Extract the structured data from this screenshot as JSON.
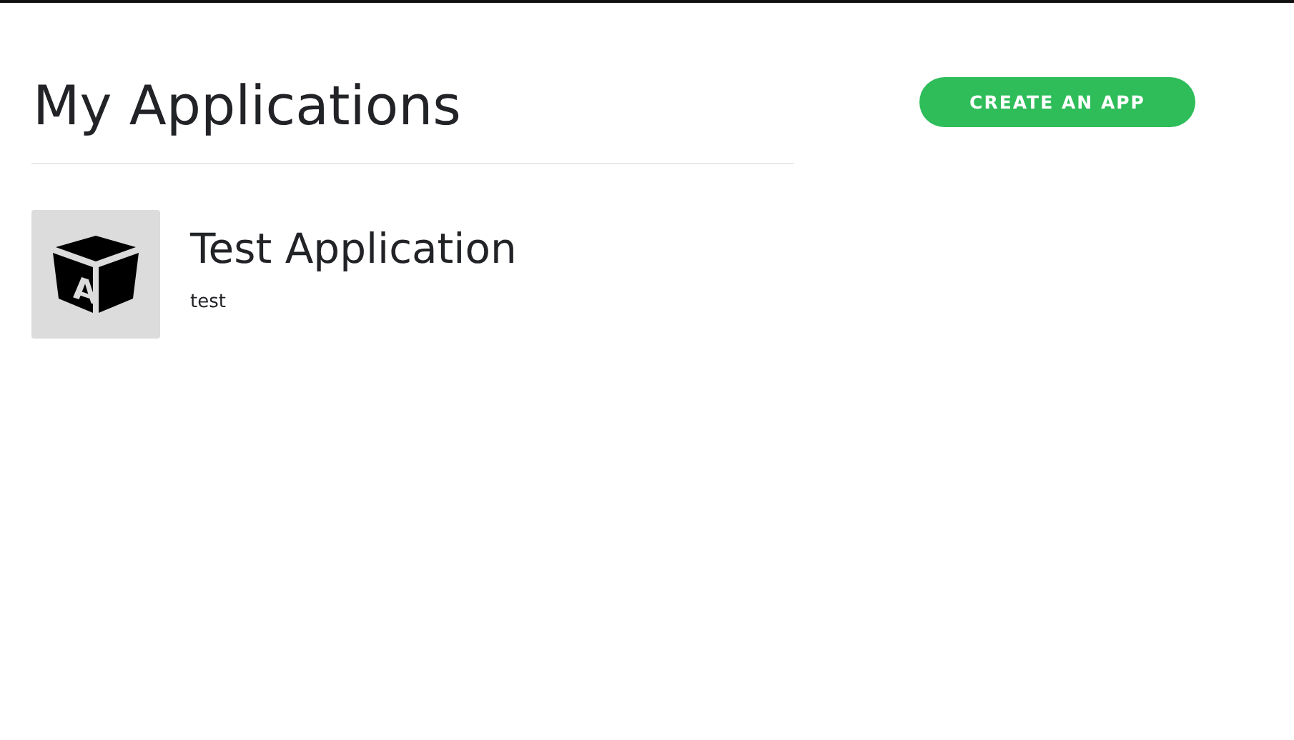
{
  "page": {
    "title": "My Applications",
    "create_button": "CREATE AN APP"
  },
  "applications": [
    {
      "name": "Test Application",
      "description": "test",
      "icon_letter": "A"
    }
  ]
}
